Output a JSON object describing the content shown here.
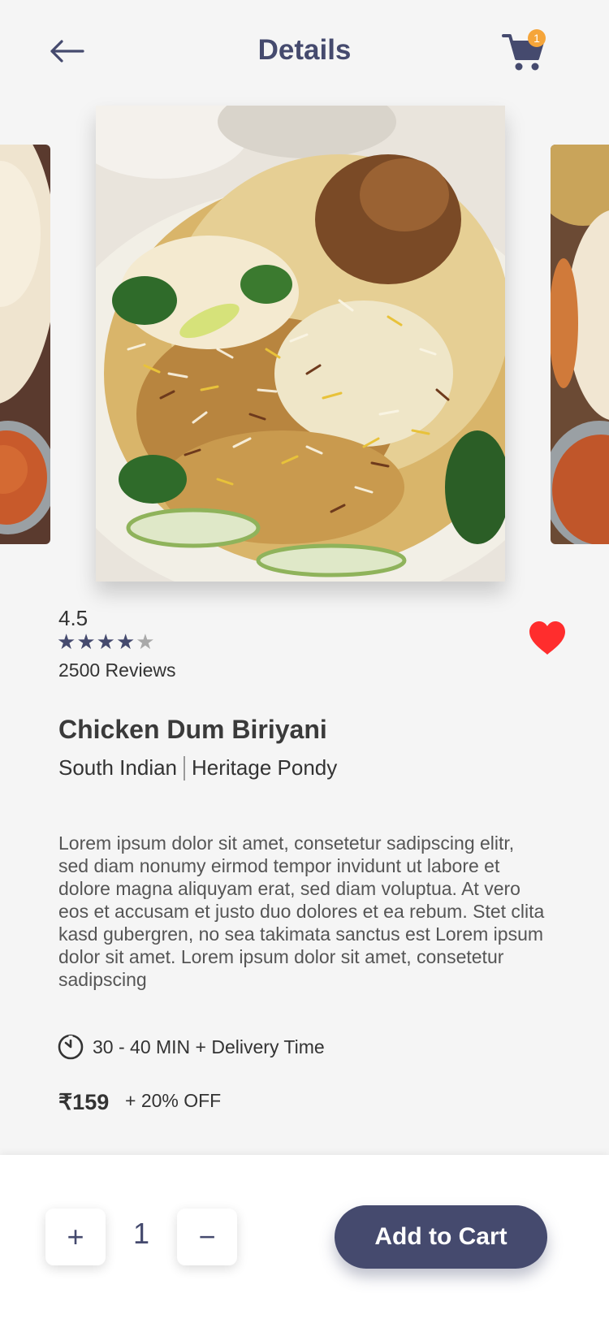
{
  "header": {
    "title": "Details",
    "back_icon": "arrow-left-icon",
    "cart_icon": "shopping-cart-icon",
    "cart_count": "1",
    "badge_color": "#f5a53a"
  },
  "carousel": {
    "main_image": "chicken-biriyani-photo",
    "left_image": "dosa-photo",
    "right_image": "dosa-photo"
  },
  "rating": {
    "value": "4.5",
    "stars_filled": 4,
    "stars_total": 5,
    "reviews": "2500 Reviews"
  },
  "favorite": {
    "icon": "heart-icon",
    "active": true,
    "color": "#ff2d2d"
  },
  "dish": {
    "name": "Chicken Dum Biriyani",
    "cuisine": "South Indian",
    "restaurant": "Heritage Pondy",
    "description": "Lorem ipsum dolor sit amet, consetetur sadipscing elitr, sed diam nonumy eirmod tempor invidunt ut labore et dolore magna aliquyam erat, sed diam voluptua. At vero eos et accusam et justo duo dolores et ea rebum. Stet clita kasd gubergren, no sea takimata sanctus est Lorem ipsum dolor sit amet. Lorem ipsum dolor sit amet, consetetur sadipscing",
    "delivery_time": "30 - 40 MIN + Delivery Time",
    "price": "₹159",
    "offer": "+ 20% OFF"
  },
  "cart_controls": {
    "plus": "+",
    "quantity": "1",
    "minus": "−",
    "add_to_cart": "Add to Cart"
  },
  "colors": {
    "accent": "#454a6e",
    "background": "#f5f5f5"
  }
}
